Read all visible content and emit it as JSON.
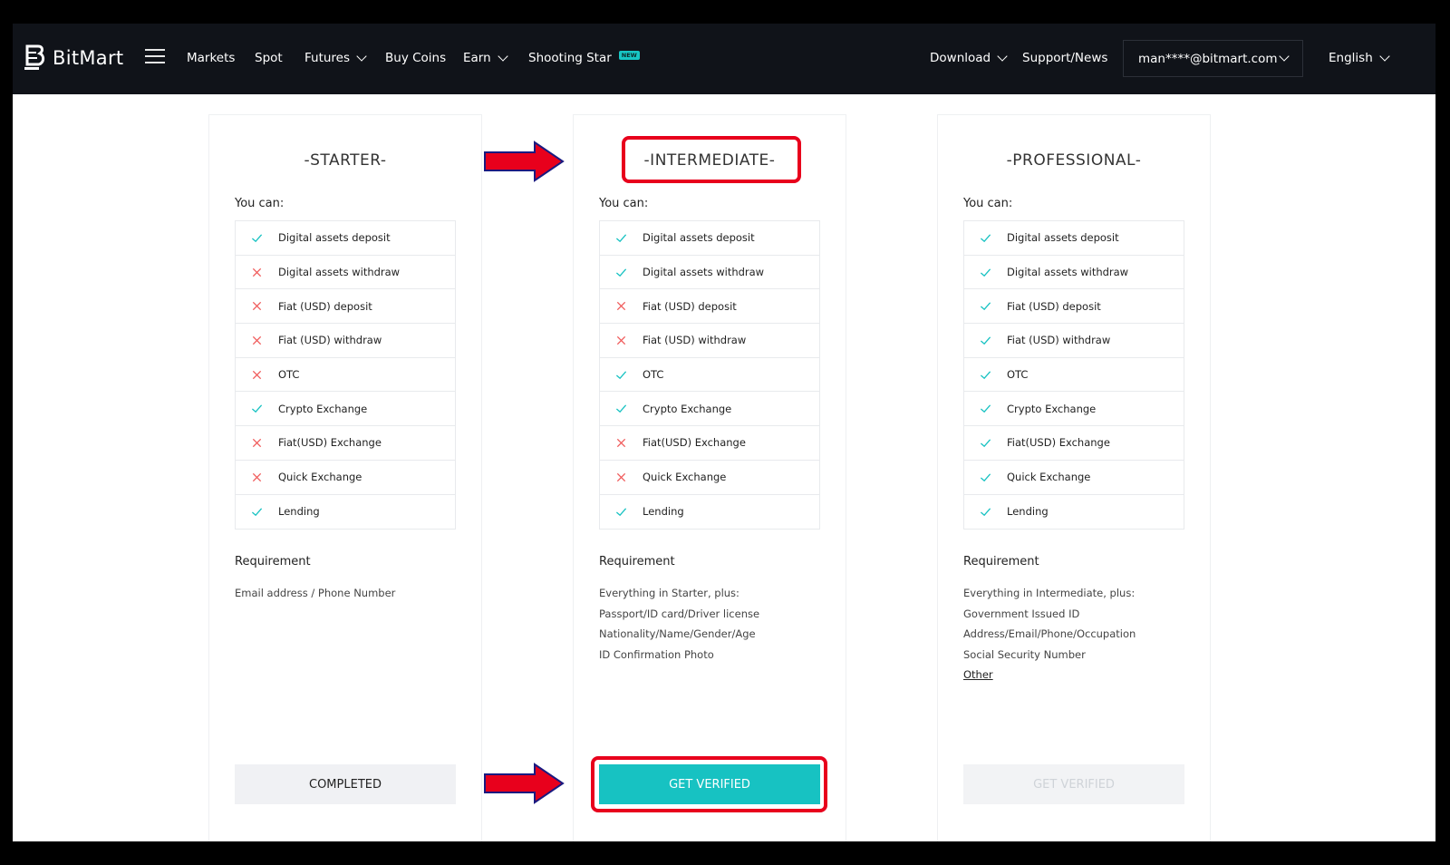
{
  "nav": {
    "logo_text": "BitMart",
    "items": [
      "Markets",
      "Spot",
      "Futures",
      "Buy Coins",
      "Earn",
      "Shooting Star"
    ],
    "new_badge": "NEW",
    "download": "Download",
    "support": "Support/News",
    "account": "man****@bitmart.com",
    "language": "English"
  },
  "tiers": [
    {
      "title": "-STARTER-",
      "you_can": "You can:",
      "features": [
        {
          "label": "Digital assets deposit",
          "allowed": true
        },
        {
          "label": "Digital assets withdraw",
          "allowed": false
        },
        {
          "label": "Fiat (USD) deposit",
          "allowed": false
        },
        {
          "label": "Fiat (USD) withdraw",
          "allowed": false
        },
        {
          "label": "OTC",
          "allowed": false
        },
        {
          "label": "Crypto Exchange",
          "allowed": true
        },
        {
          "label": "Fiat(USD) Exchange",
          "allowed": false
        },
        {
          "label": "Quick Exchange",
          "allowed": false
        },
        {
          "label": "Lending",
          "allowed": true
        }
      ],
      "requirement_title": "Requirement",
      "requirements": [
        "Email address / Phone Number"
      ],
      "button": "COMPLETED"
    },
    {
      "title": "-INTERMEDIATE-",
      "you_can": "You can:",
      "features": [
        {
          "label": "Digital assets deposit",
          "allowed": true
        },
        {
          "label": "Digital assets withdraw",
          "allowed": true
        },
        {
          "label": "Fiat (USD) deposit",
          "allowed": false
        },
        {
          "label": "Fiat (USD) withdraw",
          "allowed": false
        },
        {
          "label": "OTC",
          "allowed": true
        },
        {
          "label": "Crypto Exchange",
          "allowed": true
        },
        {
          "label": "Fiat(USD) Exchange",
          "allowed": false
        },
        {
          "label": "Quick Exchange",
          "allowed": false
        },
        {
          "label": "Lending",
          "allowed": true
        }
      ],
      "requirement_title": "Requirement",
      "requirements": [
        "Everything in Starter, plus:",
        "Passport/ID card/Driver license",
        "Nationality/Name/Gender/Age",
        "ID Confirmation Photo"
      ],
      "button": "GET VERIFIED"
    },
    {
      "title": "-PROFESSIONAL-",
      "you_can": "You can:",
      "features": [
        {
          "label": "Digital assets deposit",
          "allowed": true
        },
        {
          "label": "Digital assets withdraw",
          "allowed": true
        },
        {
          "label": "Fiat (USD) deposit",
          "allowed": true
        },
        {
          "label": "Fiat (USD) withdraw",
          "allowed": true
        },
        {
          "label": "OTC",
          "allowed": true
        },
        {
          "label": "Crypto Exchange",
          "allowed": true
        },
        {
          "label": "Fiat(USD) Exchange",
          "allowed": true
        },
        {
          "label": "Quick Exchange",
          "allowed": true
        },
        {
          "label": "Lending",
          "allowed": true
        }
      ],
      "requirement_title": "Requirement",
      "requirements": [
        "Everything in Intermediate, plus:",
        "Government Issued ID",
        "Address/Email/Phone/Occupation",
        "Social Security Number"
      ],
      "requirement_link": "Other",
      "button": "GET VERIFIED"
    }
  ],
  "colors": {
    "check": "#17c2c2",
    "cross": "#f05a5a",
    "highlight": "#e8001c",
    "primary": "#17c2c2"
  }
}
